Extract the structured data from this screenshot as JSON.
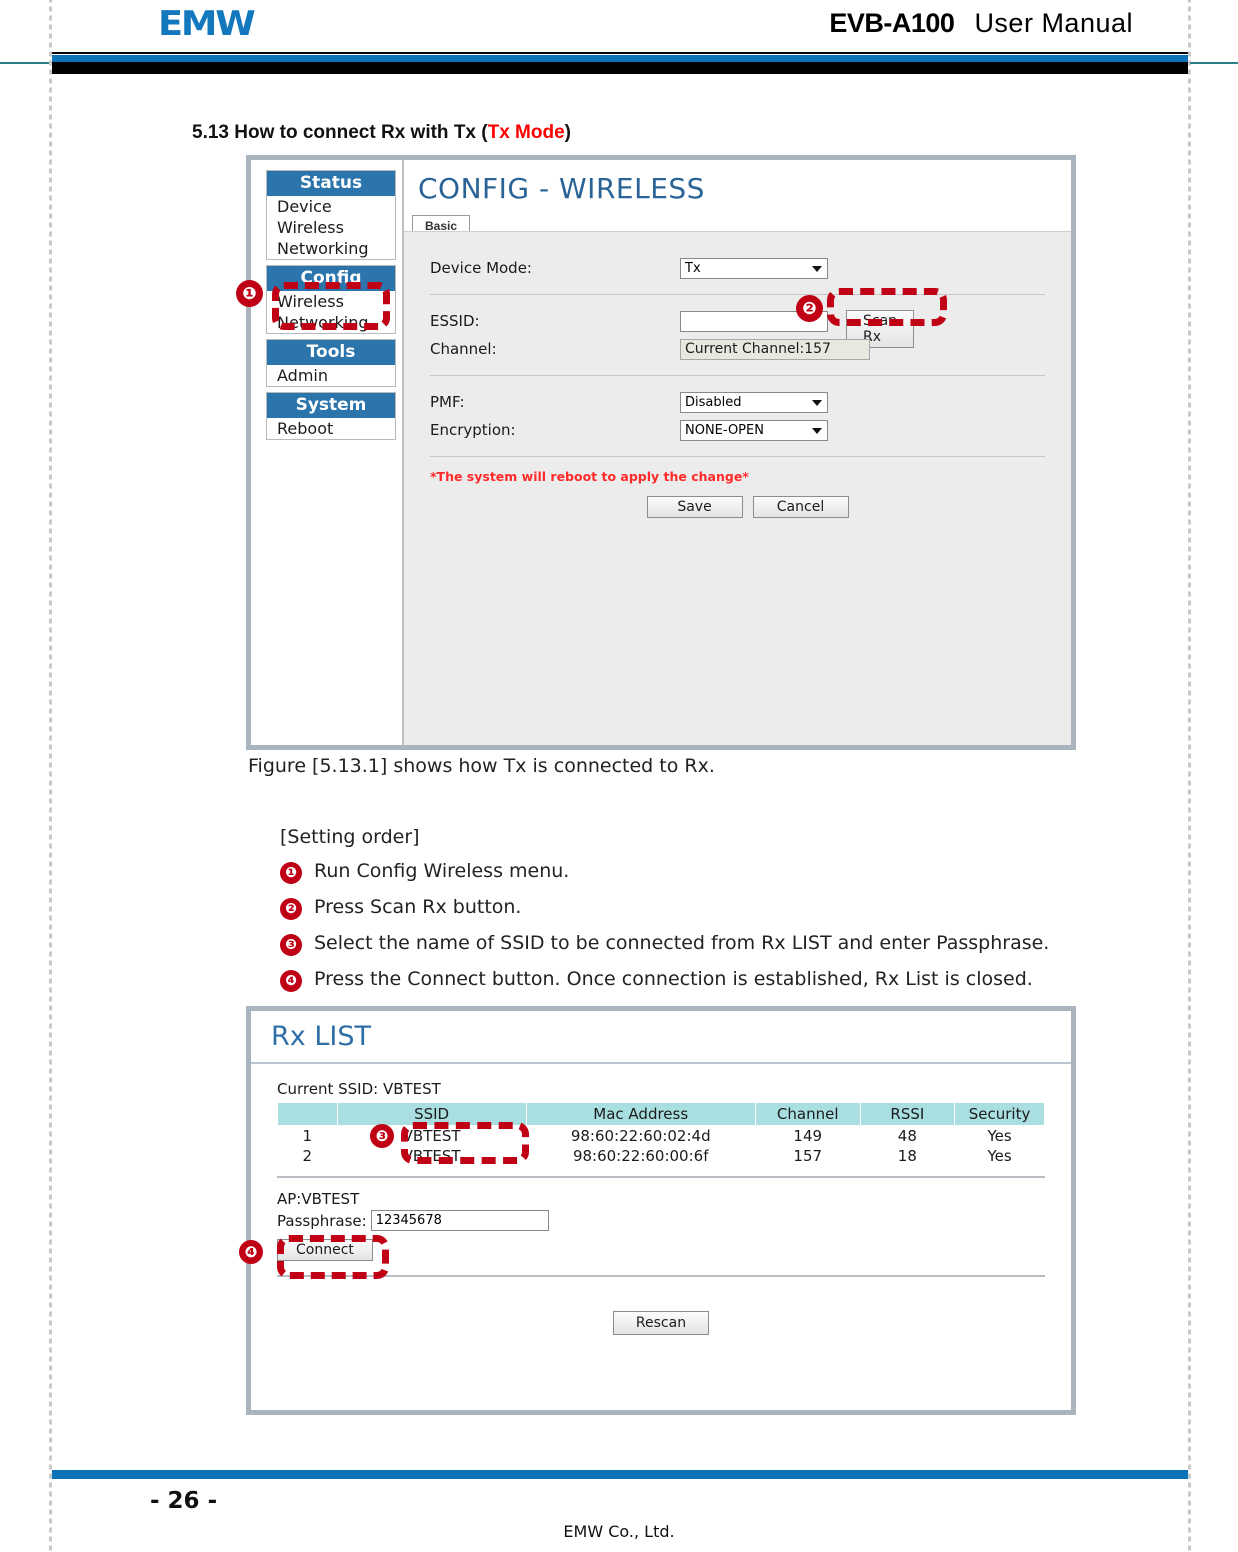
{
  "header": {
    "logo_text": "EMW",
    "model": "EVB-A100",
    "doc_type": "User  Manual"
  },
  "section": {
    "number_title": "5.13 How to connect Rx with Tx (",
    "highlight": "Tx Mode",
    "closing": ")"
  },
  "config_screenshot": {
    "sidebar": [
      {
        "header": "Status",
        "items": [
          "Device",
          "Wireless",
          "Networking"
        ]
      },
      {
        "header": "Config",
        "items": [
          "Wireless",
          "Networking"
        ]
      },
      {
        "header": "Tools",
        "items": [
          "Admin"
        ]
      },
      {
        "header": "System",
        "items": [
          "Reboot"
        ]
      }
    ],
    "page_title": "CONFIG - WIRELESS",
    "tab": "Basic",
    "fields": {
      "device_mode_label": "Device Mode:",
      "device_mode_value": "Tx",
      "essid_label": "ESSID:",
      "essid_value": "",
      "scan_rx_button": "Scan Rx",
      "channel_label": "Channel:",
      "channel_value": "Current Channel:157",
      "pmf_label": "PMF:",
      "pmf_value": "Disabled",
      "encryption_label": "Encryption:",
      "encryption_value": "NONE-OPEN"
    },
    "warning": "*The system will reboot to apply the change*",
    "save_button": "Save",
    "cancel_button": "Cancel",
    "annotations": {
      "one": "❶",
      "two": "❷"
    }
  },
  "figure_caption": "Figure [5.13.1] shows how Tx is connected to Rx.",
  "setting_order": {
    "title": "[Setting order]",
    "steps": [
      {
        "num": "❶",
        "text": "Run Config Wireless menu."
      },
      {
        "num": "❷",
        "text": "Press Scan Rx button."
      },
      {
        "num": "❸",
        "text": "Select the name of SSID to be connected from Rx LIST and enter Passphrase."
      },
      {
        "num": "❹",
        "text": "Press the Connect button. Once connection is established, Rx List is closed."
      }
    ]
  },
  "rx_list_screenshot": {
    "title": "Rx LIST",
    "current_ssid": "Current SSID: VBTEST",
    "columns": [
      "",
      "SSID",
      "Mac Address",
      "Channel",
      "RSSI",
      "Security"
    ],
    "rows": [
      {
        "idx": "1",
        "ssid": "VBTEST",
        "mac": "98:60:22:60:02:4d",
        "channel": "149",
        "rssi": "48",
        "security": "Yes"
      },
      {
        "idx": "2",
        "ssid": "VBTEST",
        "mac": "98:60:22:60:00:6f",
        "channel": "157",
        "rssi": "18",
        "security": "Yes"
      }
    ],
    "ap_label": "AP:VBTEST",
    "passphrase_label": "Passphrase:",
    "passphrase_value": "12345678",
    "connect_button": "Connect",
    "rescan_button": "Rescan",
    "annotations": {
      "three": "❸",
      "four": "❹"
    }
  },
  "footer": {
    "page_number": "- 26 -",
    "company": "EMW Co., Ltd."
  },
  "colors": {
    "brand_blue": "#0d73b8",
    "nav_blue": "#2b74ac",
    "annotation_red": "#c00014",
    "warning_red": "#ff2a2a",
    "table_header_teal": "#a9dfe1"
  }
}
